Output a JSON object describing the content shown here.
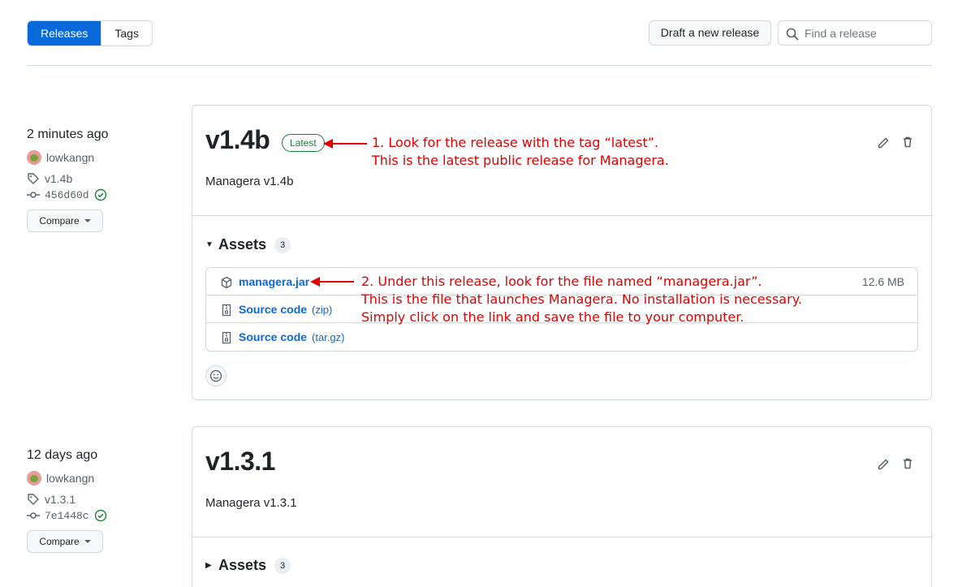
{
  "tabs": [
    {
      "label": "Releases",
      "active": true
    },
    {
      "label": "Tags",
      "active": false
    }
  ],
  "actions": {
    "draft_label": "Draft a new release",
    "search_placeholder": "Find a release"
  },
  "releases": [
    {
      "time": "2 minutes ago",
      "author": "lowkangn",
      "tag": "v1.4b",
      "commit": "456d60d",
      "compare_label": "Compare",
      "title": "v1.4b",
      "badge": "Latest",
      "description": "Managera v1.4b",
      "assets_label": "Assets",
      "assets_count": "3",
      "assets_expanded": true,
      "assets": [
        {
          "name": "managera.jar",
          "ext": "",
          "size": "12.6 MB",
          "icon": "package-icon"
        },
        {
          "name": "Source code",
          "ext": "(zip)",
          "size": "",
          "icon": "file-zip-icon"
        },
        {
          "name": "Source code",
          "ext": "(tar.gz)",
          "size": "",
          "icon": "file-zip-icon"
        }
      ]
    },
    {
      "time": "12 days ago",
      "author": "lowkangn",
      "tag": "v1.3.1",
      "commit": "7e1448c",
      "compare_label": "Compare",
      "title": "v1.3.1",
      "description": "Managera v1.3.1",
      "assets_label": "Assets",
      "assets_count": "3",
      "assets_expanded": false
    }
  ],
  "annotations": {
    "note1": [
      "1. Look for the release with the tag “latest”.",
      "This is the latest public release for Managera."
    ],
    "note2": [
      "2. Under this release, look for the file named “managera.jar”.",
      "This is the file that launches Managera. No installation is necessary.",
      "Simply click on the link and save the file to your computer."
    ],
    "color": "#e00000"
  },
  "colors": {
    "accent": "#0969da",
    "latest_green": "#1a7f37",
    "border": "#d0d7de"
  }
}
